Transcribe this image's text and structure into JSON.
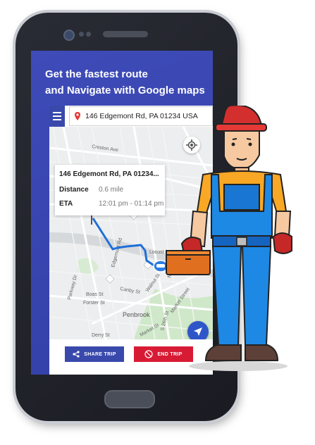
{
  "headline": {
    "line1": "Get the fastest route",
    "line2": "and Navigate with Google maps"
  },
  "search": {
    "address": "146 Edgemont Rd, PA 01234 USA"
  },
  "trip_info": {
    "address": "146 Edgemont Rd, PA 01234...",
    "distance_label": "Distance",
    "distance_value": "0.6 mile",
    "eta_label": "ETA",
    "eta_value": "12:01 pm - 01:14 pm"
  },
  "map": {
    "streets": [
      "Creston Ave",
      "Locust Ln",
      "Edgemont Rd",
      "Canby St",
      "Walnut St",
      "Boas St",
      "Parkway Dr",
      "Forster St",
      "N 29th St",
      "Derry St",
      "Market St",
      "Market Street",
      "S 26th St",
      "Penbrook"
    ]
  },
  "actions": {
    "share_label": "SHARE TRIP",
    "end_label": "END TRIP"
  },
  "colors": {
    "screen_bg": "#3a46b0",
    "primary": "#3949ab",
    "end_red": "#d81b34",
    "route_blue": "#1e6fd9"
  }
}
